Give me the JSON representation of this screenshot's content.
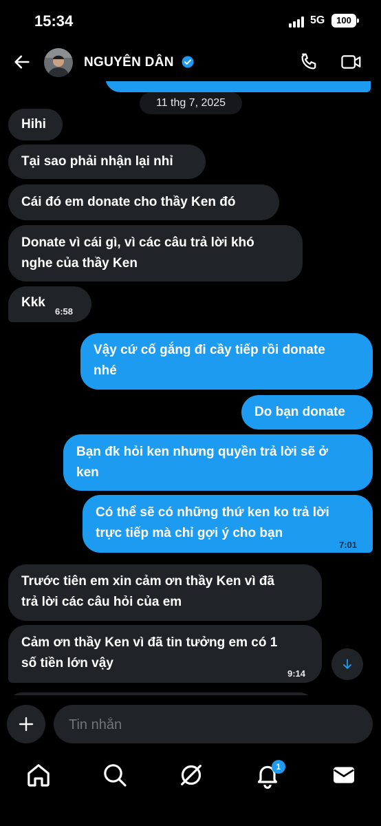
{
  "status_bar": {
    "time": "15:34",
    "network": "5G",
    "battery": "100"
  },
  "header": {
    "contact_name": "NGUYÊN DÂN"
  },
  "chat": {
    "date_separator": "11 thg 7, 2025",
    "messages": [
      {
        "direction": "in",
        "lines": [
          "Hihi"
        ]
      },
      {
        "direction": "in",
        "lines": [
          "Tại sao phải nhận lại nhỉ"
        ]
      },
      {
        "direction": "in",
        "lines": [
          "Cái đó em donate cho thầy Ken đó"
        ]
      },
      {
        "direction": "in",
        "lines": [
          "Donate vì cái gì, vì các câu trả lời khó",
          "nghe của thầy Ken"
        ]
      },
      {
        "direction": "in",
        "lines": [
          "Kkk"
        ],
        "time": "6:58"
      },
      {
        "direction": "out",
        "lines": [
          "Vậy cứ cố gắng đi cầy tiếp rồi donate",
          "nhé"
        ]
      },
      {
        "direction": "out",
        "lines": [
          "Do bạn donate"
        ]
      },
      {
        "direction": "out",
        "lines": [
          "Bạn đk hỏi ken nhưng quyền trả lời sẽ ở",
          "ken"
        ]
      },
      {
        "direction": "out",
        "lines": [
          "Có thể sẽ có những thứ ken ko trả lời",
          "trực tiếp mà chỉ gợi ý cho bạn"
        ],
        "time": "7:01"
      },
      {
        "direction": "in",
        "lines": [
          "Trước tiên em xin cảm ơn thầy Ken vì đã",
          "trả lời các câu hỏi của em"
        ]
      },
      {
        "direction": "in",
        "lines": [
          "Cảm ơn thầy Ken vì đã tin tưởng em có 1",
          "số tiền lớn vậy"
        ],
        "time": "9:14"
      }
    ]
  },
  "composer": {
    "placeholder": "Tin nhắn"
  },
  "bottom_nav": {
    "items": [
      "home-icon",
      "search-icon",
      "grok-icon",
      "notifications-icon",
      "messages-icon"
    ],
    "notification_count": "1"
  },
  "colors": {
    "accent": "#1d9bf0",
    "incoming_bubble": "#202327",
    "background": "#000000"
  }
}
